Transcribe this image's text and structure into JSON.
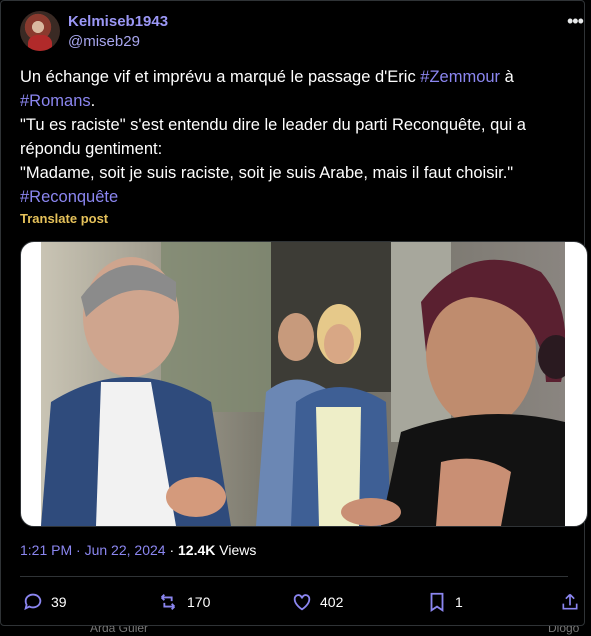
{
  "tweet": {
    "display_name": "Kelmiseb1943",
    "handle": "@miseb29",
    "more_icon": "more-horizontal-icon",
    "text_lines": [
      [
        {
          "t": "Un échange vif et imprévu a marqué le passage d'Eric "
        },
        {
          "t": "#Zemmour",
          "tag": true
        },
        {
          "t": " à"
        }
      ],
      [
        {
          "t": "#Romans",
          "tag": true
        },
        {
          "t": "."
        }
      ],
      [
        {
          "t": "\"Tu es raciste\" s'est entendu dire le leader du parti  Reconquête, qui a"
        }
      ],
      [
        {
          "t": "répondu gentiment:"
        }
      ],
      [
        {
          "t": "\"Madame, soit je suis raciste, soit je  suis Arabe, mais il faut choisir.\""
        }
      ],
      [
        {
          "t": "#Reconquête",
          "tag": true
        }
      ]
    ],
    "translate_label": "Translate post",
    "time": "1:21 PM",
    "separator": " · ",
    "date": "Jun 22, 2024",
    "views_count": "12.4K",
    "views_label": " Views",
    "replies": "39",
    "reposts": "170",
    "likes": "402",
    "bookmarks": "1"
  },
  "colors": {
    "accent": "#8b86f0",
    "name": "#9b97f5",
    "translate": "#e5c15a",
    "border": "#2f3336"
  },
  "bottom_strip": {
    "left_text": "Arda Güler",
    "right_text": "Diogo"
  }
}
